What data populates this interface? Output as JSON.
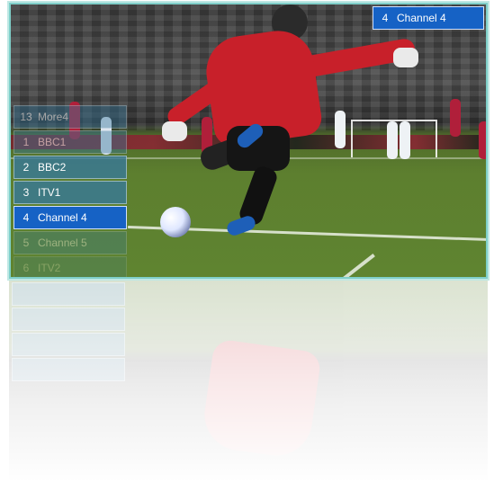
{
  "now_playing": {
    "number": "4",
    "name": "Channel 4"
  },
  "channel_list": [
    {
      "number": "13",
      "name": "More4"
    },
    {
      "number": "1",
      "name": "BBC1"
    },
    {
      "number": "2",
      "name": "BBC2"
    },
    {
      "number": "3",
      "name": "ITV1"
    },
    {
      "number": "4",
      "name": "Channel 4"
    },
    {
      "number": "5",
      "name": "Channel 5"
    },
    {
      "number": "6",
      "name": "ITV2"
    }
  ],
  "colors": {
    "selected": "#1662c5",
    "item": "#3778a0",
    "frame": "#7fcfc9",
    "keeper_jersey": "#c8202a",
    "pitch": "#5d7f2f"
  },
  "icons": [
    "soccer-ball-icon"
  ]
}
